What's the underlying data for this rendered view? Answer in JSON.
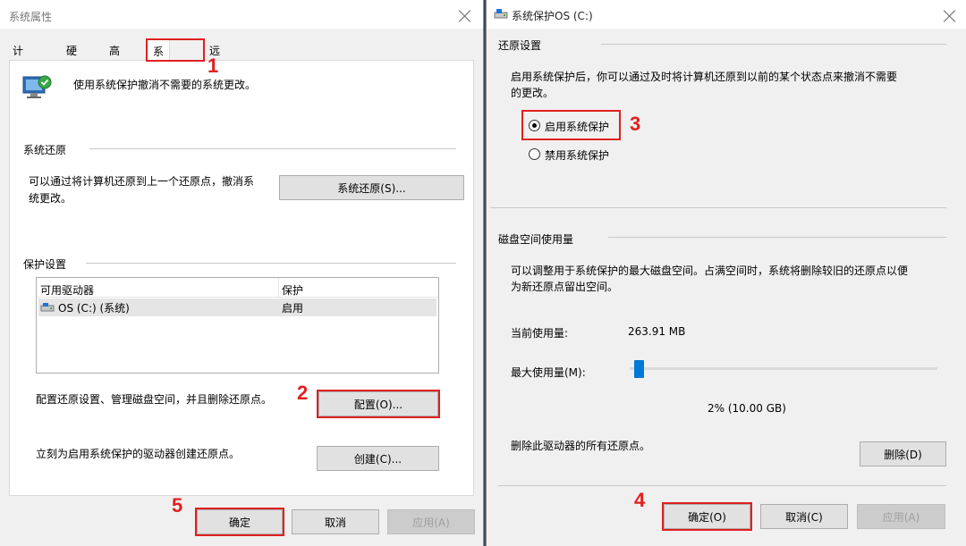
{
  "left_dialog": {
    "title": "系统属性",
    "tabs": [
      "计算机名",
      "硬件",
      "高级",
      "系统保护",
      "远程"
    ],
    "intro_text": "使用系统保护撤消不需要的系统更改。",
    "restore_group": {
      "header": "系统还原",
      "description_line1": "可以通过将计算机还原到上一个还原点，撤消系",
      "description_line2": "统更改。",
      "button": "系统还原(S)..."
    },
    "protection_group": {
      "header": "保护设置",
      "columns": [
        "可用驱动器",
        "保护"
      ],
      "rows": [
        {
          "drive": "OS (C:) (系统)",
          "protection": "启用"
        }
      ],
      "configure_text": "配置还原设置、管理磁盘空间，并且删除还原点。",
      "configure_button": "配置(O)...",
      "create_text": "立刻为启用系统保护的驱动器创建还原点。",
      "create_button": "创建(C)..."
    },
    "footer": {
      "ok": "确定",
      "cancel": "取消",
      "apply": "应用(A)"
    }
  },
  "right_dialog": {
    "title": "系统保护OS (C:)",
    "restore_settings": {
      "header": "还原设置",
      "description_line1": "启用系统保护后，你可以通过及时将计算机还原到以前的某个状态点来撤消不需要",
      "description_line2": "的更改。",
      "options": [
        {
          "label": "启用系统保护",
          "selected": true
        },
        {
          "label": "禁用系统保护",
          "selected": false
        }
      ]
    },
    "disk_usage": {
      "header": "磁盘空间使用量",
      "description_line1": "可以调整用于系统保护的最大磁盘空间。占满空间时，系统将删除较旧的还原点以便",
      "description_line2": "为新还原点留出空间。",
      "current_label": "当前使用量:",
      "current_value": "263.91 MB",
      "max_label": "最大使用量(M):",
      "max_percent": 2,
      "max_value_text": "2% (10.00 GB)",
      "delete_text": "删除此驱动器的所有还原点。",
      "delete_button": "删除(D)"
    },
    "footer": {
      "ok": "确定(O)",
      "cancel": "取消(C)",
      "apply": "应用(A)"
    }
  },
  "callouts": [
    "1",
    "2",
    "3",
    "4",
    "5"
  ],
  "colors": {
    "callout": "#e02020",
    "accent": "#0078d7",
    "list_selected": "#e5e5e5"
  }
}
